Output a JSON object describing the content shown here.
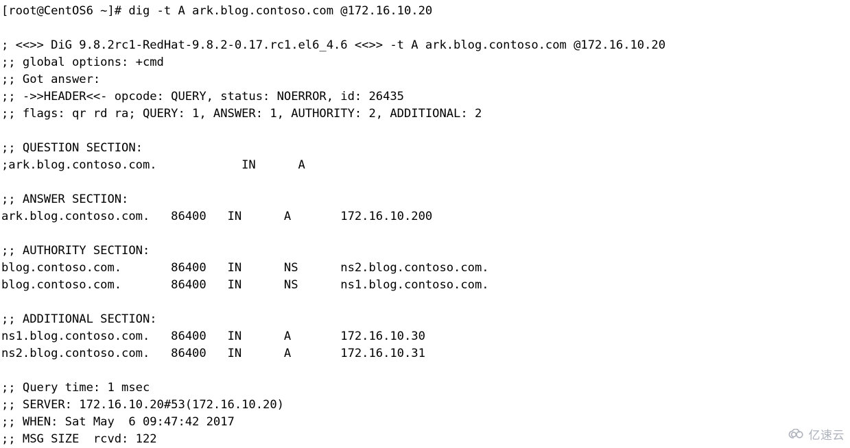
{
  "terminal": {
    "prompt_line": "[root@CentOS6 ~]# dig -t A ark.blog.contoso.com @172.16.10.20",
    "prompt": {
      "user": "root",
      "host": "CentOS6",
      "cwd": "~",
      "symbol": "#",
      "command": "dig -t A ark.blog.contoso.com @172.16.10.20"
    },
    "lines": [
      "[root@CentOS6 ~]# dig -t A ark.blog.contoso.com @172.16.10.20",
      "",
      "; <<>> DiG 9.8.2rc1-RedHat-9.8.2-0.17.rc1.el6_4.6 <<>> -t A ark.blog.contoso.com @172.16.10.20",
      ";; global options: +cmd",
      ";; Got answer:",
      ";; ->>HEADER<<- opcode: QUERY, status: NOERROR, id: 26435",
      ";; flags: qr rd ra; QUERY: 1, ANSWER: 1, AUTHORITY: 2, ADDITIONAL: 2",
      "",
      ";; QUESTION SECTION:",
      ";ark.blog.contoso.com.            IN      A",
      "",
      ";; ANSWER SECTION:",
      "ark.blog.contoso.com.   86400   IN      A       172.16.10.200",
      "",
      ";; AUTHORITY SECTION:",
      "blog.contoso.com.       86400   IN      NS      ns2.blog.contoso.com.",
      "blog.contoso.com.       86400   IN      NS      ns1.blog.contoso.com.",
      "",
      ";; ADDITIONAL SECTION:",
      "ns1.blog.contoso.com.   86400   IN      A       172.16.10.30",
      "ns2.blog.contoso.com.   86400   IN      A       172.16.10.31",
      "",
      ";; Query time: 1 msec",
      ";; SERVER: 172.16.10.20#53(172.16.10.20)",
      ";; WHEN: Sat May  6 09:47:42 2017",
      ";; MSG SIZE  rcvd: 122"
    ],
    "dig_version_line": "; <<>> DiG 9.8.2rc1-RedHat-9.8.2-0.17.rc1.el6_4.6 <<>> -t A ark.blog.contoso.com @172.16.10.20",
    "global_options_line": ";; global options: +cmd",
    "got_answer_line": ";; Got answer:",
    "header_line": ";; ->>HEADER<<- opcode: QUERY, status: NOERROR, id: 26435",
    "flags_line": ";; flags: qr rd ra; QUERY: 1, ANSWER: 1, AUTHORITY: 2, ADDITIONAL: 2",
    "header": {
      "opcode": "QUERY",
      "status": "NOERROR",
      "id": "26435",
      "flags": "qr rd ra",
      "query_count": "1",
      "answer_count": "1",
      "authority_count": "2",
      "additional_count": "2"
    },
    "sections": {
      "question": {
        "title": ";; QUESTION SECTION:",
        "rows": [
          {
            "name": ";ark.blog.contoso.com.",
            "ttl": "",
            "class": "IN",
            "type": "A",
            "value": ""
          }
        ]
      },
      "answer": {
        "title": ";; ANSWER SECTION:",
        "rows": [
          {
            "name": "ark.blog.contoso.com.",
            "ttl": "86400",
            "class": "IN",
            "type": "A",
            "value": "172.16.10.200"
          }
        ]
      },
      "authority": {
        "title": ";; AUTHORITY SECTION:",
        "rows": [
          {
            "name": "blog.contoso.com.",
            "ttl": "86400",
            "class": "IN",
            "type": "NS",
            "value": "ns2.blog.contoso.com."
          },
          {
            "name": "blog.contoso.com.",
            "ttl": "86400",
            "class": "IN",
            "type": "NS",
            "value": "ns1.blog.contoso.com."
          }
        ]
      },
      "additional": {
        "title": ";; ADDITIONAL SECTION:",
        "rows": [
          {
            "name": "ns1.blog.contoso.com.",
            "ttl": "86400",
            "class": "IN",
            "type": "A",
            "value": "172.16.10.30"
          },
          {
            "name": "ns2.blog.contoso.com.",
            "ttl": "86400",
            "class": "IN",
            "type": "A",
            "value": "172.16.10.31"
          }
        ]
      }
    },
    "footer": {
      "query_time_line": ";; Query time: 1 msec",
      "server_line": ";; SERVER: 172.16.10.20#53(172.16.10.20)",
      "when_line": ";; WHEN: Sat May  6 09:47:42 2017",
      "msg_size_line": ";; MSG SIZE  rcvd: 122",
      "query_time": "1 msec",
      "server": "172.16.10.20#53(172.16.10.20)",
      "when": "Sat May  6 09:47:42 2017",
      "msg_size": "122"
    },
    "colors": {
      "background": "#ffffff",
      "foreground": "#000000"
    }
  },
  "watermark": {
    "text": "亿速云",
    "icon": "cloud-icon",
    "color": "#a9aeb8"
  }
}
